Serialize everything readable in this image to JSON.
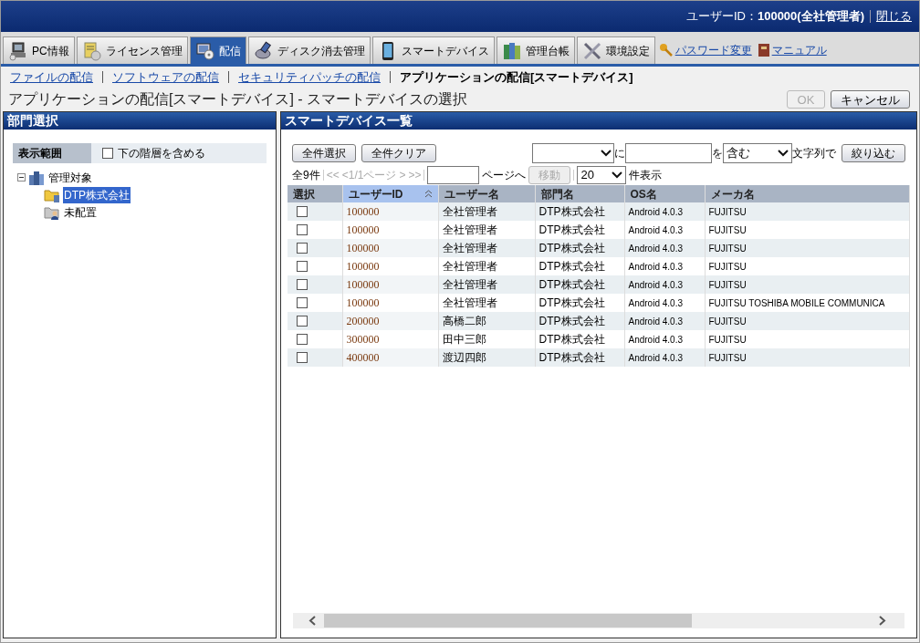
{
  "header": {
    "user_label": "ユーザーID：",
    "user_value": "100000(全社管理者)",
    "close_link": "閉じる"
  },
  "tabs": [
    {
      "label": "PC情報",
      "kind": "pc",
      "selected": false
    },
    {
      "label": "ライセンス管理",
      "kind": "license",
      "selected": false
    },
    {
      "label": "配信",
      "kind": "deliver",
      "selected": true
    },
    {
      "label": "ディスク消去管理",
      "kind": "disk",
      "selected": false
    },
    {
      "label": "スマートデバイス",
      "kind": "phone",
      "selected": false
    },
    {
      "label": "管理台帳",
      "kind": "books",
      "selected": false
    },
    {
      "label": "環境設定",
      "kind": "tools",
      "selected": false
    }
  ],
  "top_links": [
    {
      "label": "パスワード変更",
      "kind": "key"
    },
    {
      "label": "マニュアル",
      "kind": "book"
    }
  ],
  "subnav": [
    {
      "label": "ファイルの配信",
      "selected": false
    },
    {
      "label": "ソフトウェアの配信",
      "selected": false
    },
    {
      "label": "セキュリティパッチの配信",
      "selected": false
    },
    {
      "label": "アプリケーションの配信[スマートデバイス]",
      "selected": true
    }
  ],
  "page_title": "アプリケーションの配信[スマートデバイス] - スマートデバイスの選択",
  "page_buttons": [
    {
      "label": "OK",
      "disabled": true
    },
    {
      "label": "キャンセル",
      "disabled": false
    }
  ],
  "left_panel": {
    "title": "部門選択",
    "scope_label": "表示範囲",
    "include_sub": {
      "label": "下の階層を含める",
      "checked": false
    },
    "tree": [
      {
        "label": "管理対象",
        "kind": "building",
        "expanded": true,
        "selected": false,
        "children": [
          {
            "label": "DTP株式会社",
            "kind": "folder",
            "selected": true
          },
          {
            "label": "未配置",
            "kind": "person-folder",
            "selected": false
          }
        ]
      }
    ]
  },
  "right_panel": {
    "title": "スマートデバイス一覧",
    "buttons": [
      "全件選択",
      "全件クリア"
    ],
    "filter": {
      "connector_1": "に",
      "connector_2": "を",
      "match_select": "含む",
      "suffix": "文字列で",
      "button": "絞り込む"
    },
    "pager": {
      "total": "全9件",
      "links": [
        {
          "label": "<<",
          "disabled": true
        },
        {
          "label": "<1/1ページ",
          "disabled": true
        },
        {
          "label": ">",
          "disabled": true
        },
        {
          "label": ">>",
          "disabled": true
        }
      ],
      "goto_suffix": "ページへ",
      "move_button": {
        "label": "移動",
        "disabled": true
      },
      "per_page": "20",
      "per_page_suffix": "件表示"
    },
    "table": {
      "columns": [
        {
          "label": "選択",
          "sorted": false
        },
        {
          "label": "ユーザーID",
          "sorted": true
        },
        {
          "label": "ユーザー名",
          "sorted": false
        },
        {
          "label": "部門名",
          "sorted": false
        },
        {
          "label": "OS名",
          "sorted": false
        },
        {
          "label": "メーカ名",
          "sorted": false
        }
      ],
      "rows": [
        {
          "cells": [
            {
              "checked": false
            },
            "100000",
            "全社管理者",
            "DTP株式会社",
            "Android 4.0.3",
            "FUJITSU"
          ]
        },
        {
          "cells": [
            {
              "checked": false
            },
            "100000",
            "全社管理者",
            "DTP株式会社",
            "Android 4.0.3",
            "FUJITSU"
          ]
        },
        {
          "cells": [
            {
              "checked": false
            },
            "100000",
            "全社管理者",
            "DTP株式会社",
            "Android 4.0.3",
            "FUJITSU"
          ]
        },
        {
          "cells": [
            {
              "checked": false
            },
            "100000",
            "全社管理者",
            "DTP株式会社",
            "Android 4.0.3",
            "FUJITSU"
          ]
        },
        {
          "cells": [
            {
              "checked": false
            },
            "100000",
            "全社管理者",
            "DTP株式会社",
            "Android 4.0.3",
            "FUJITSU"
          ]
        },
        {
          "cells": [
            {
              "checked": false
            },
            "100000",
            "全社管理者",
            "DTP株式会社",
            "Android 4.0.3",
            "FUJITSU TOSHIBA MOBILE COMMUNICA"
          ]
        },
        {
          "cells": [
            {
              "checked": false
            },
            "200000",
            "高橋二郎",
            "DTP株式会社",
            "Android 4.0.3",
            "FUJITSU"
          ]
        },
        {
          "cells": [
            {
              "checked": false
            },
            "300000",
            "田中三郎",
            "DTP株式会社",
            "Android 4.0.3",
            "FUJITSU"
          ]
        },
        {
          "cells": [
            {
              "checked": false
            },
            "400000",
            "渡辺四郎",
            "DTP株式会社",
            "Android 4.0.3",
            "FUJITSU"
          ]
        }
      ]
    }
  }
}
